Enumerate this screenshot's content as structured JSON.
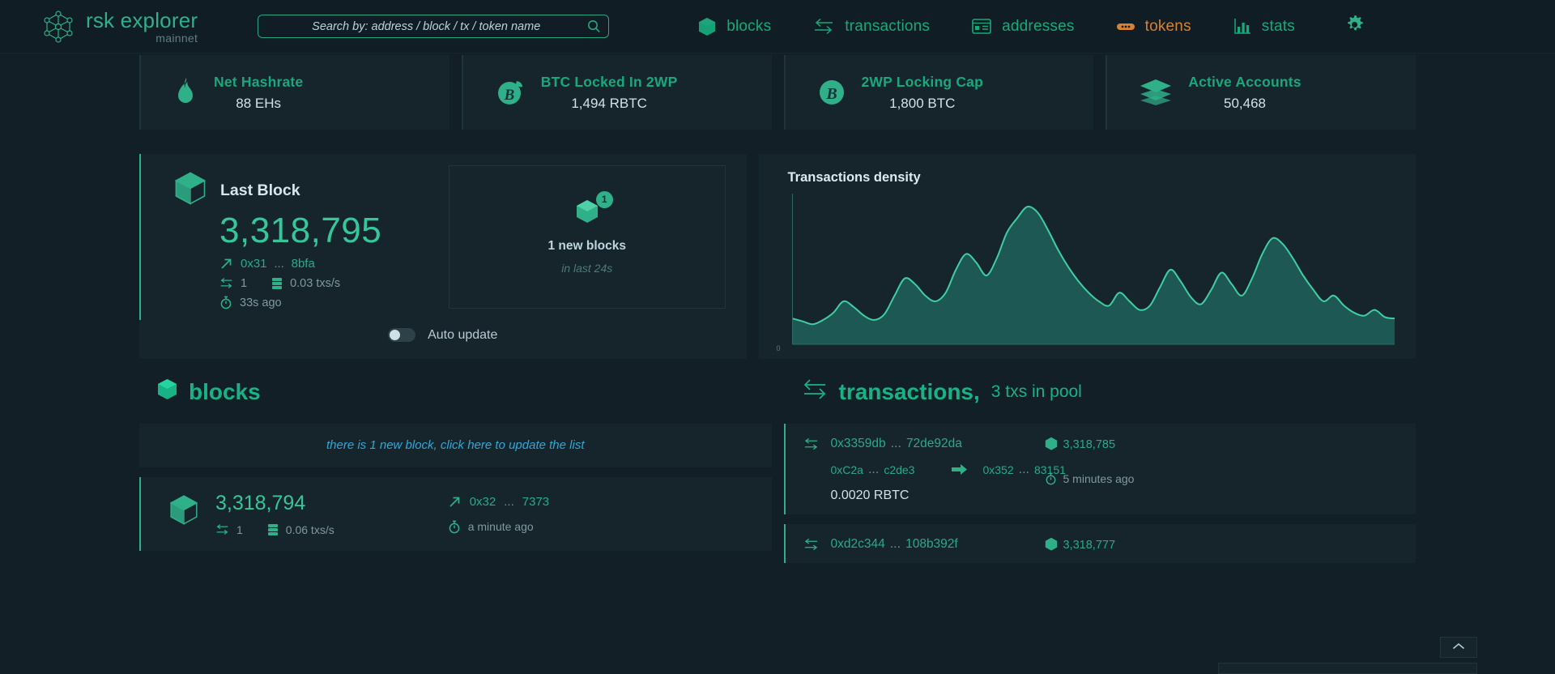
{
  "header": {
    "brand_title": "rsk explorer",
    "brand_sub": "mainnet",
    "logo_icon": "rsk-network-logo",
    "search": {
      "placeholder": "Search by: address / block / tx / token name",
      "value": "",
      "icon": "search-icon"
    },
    "nav": [
      {
        "label": "blocks",
        "icon": "cube-icon",
        "accent": false
      },
      {
        "label": "transactions",
        "icon": "swap-icon",
        "accent": false
      },
      {
        "label": "addresses",
        "icon": "card-icon",
        "accent": false
      },
      {
        "label": "tokens",
        "icon": "token-icon",
        "accent": true
      },
      {
        "label": "stats",
        "icon": "bar-chart-icon",
        "accent": false
      }
    ],
    "settings_icon": "gear-icon"
  },
  "stats": [
    {
      "label": "Net Hashrate",
      "value": "88 EHs",
      "icon": "flame-icon"
    },
    {
      "label": "BTC Locked In 2WP",
      "value": "1,494 RBTC",
      "icon": "bitcoin-leaf-icon"
    },
    {
      "label": "2WP Locking Cap",
      "value": "1,800 BTC",
      "icon": "bitcoin-icon"
    },
    {
      "label": "Active Accounts",
      "value": "50,468",
      "icon": "layers-icon"
    }
  ],
  "last_block": {
    "title": "Last Block",
    "icon": "cube-icon",
    "number": "3,318,795",
    "hash_prefix": "0x31",
    "hash_dots": "...",
    "hash_suffix": "8bfa",
    "tx_count": "1",
    "tx_rate": "0.03 txs/s",
    "age": "33s ago"
  },
  "new_blocks": {
    "badge": "1",
    "title": "1 new blocks",
    "subtitle": "in last 24s",
    "icon": "cube-icon"
  },
  "auto_update": {
    "label": "Auto update",
    "enabled": false
  },
  "chart_data": {
    "type": "area",
    "title": "Transactions density",
    "xlabel": "",
    "ylabel": "",
    "ylim": [
      0,
      100
    ],
    "grid": false,
    "legend": "none",
    "axis_zero_label": "0",
    "line_color": "#3ecfa4",
    "fill_color": "#1d5c56",
    "x": [
      0,
      1,
      2,
      3,
      4,
      5,
      6,
      7,
      8,
      9,
      10,
      11,
      12,
      13,
      14,
      15,
      16,
      17,
      18,
      19,
      20,
      21,
      22,
      23,
      24,
      25,
      26,
      27,
      28,
      29,
      30,
      31,
      32,
      33,
      34,
      35,
      36,
      37,
      38,
      39,
      40,
      41,
      42,
      43,
      44,
      45,
      46,
      47,
      48,
      49,
      50,
      51,
      52,
      53,
      54
    ],
    "values": [
      18,
      16,
      14,
      17,
      22,
      30,
      26,
      20,
      17,
      21,
      34,
      46,
      42,
      34,
      30,
      36,
      52,
      63,
      57,
      48,
      60,
      78,
      88,
      96,
      92,
      80,
      66,
      54,
      44,
      36,
      30,
      27,
      36,
      30,
      24,
      27,
      40,
      52,
      44,
      33,
      28,
      38,
      50,
      42,
      34,
      46,
      63,
      74,
      70,
      60,
      48,
      38,
      30,
      34,
      27,
      22,
      20,
      24,
      19,
      18
    ]
  },
  "blocks_section": {
    "title": "blocks",
    "icon": "cube-icon",
    "notice": "there is 1 new block, click here to update the list",
    "rows": [
      {
        "number": "3,318,794",
        "tx_count": "1",
        "tx_rate": "0.06 txs/s",
        "hash_prefix": "0x32",
        "hash_dots": "...",
        "hash_suffix": "7373",
        "age": "a minute ago"
      }
    ]
  },
  "transactions_section": {
    "title": "transactions,",
    "subtitle": "3 txs in pool",
    "icon": "swap-icon",
    "rows": [
      {
        "hash_prefix": "0x3359db",
        "hash_dots": "...",
        "hash_suffix": "72de92da",
        "block": "3,318,785",
        "from_addr": "0xC2a",
        "from_dots": "...",
        "from_suffix": "c2de3",
        "to_addr": "0x352",
        "to_dots": "...",
        "to_suffix": "83151",
        "time": "5 minutes ago",
        "value": "0.0020 RBTC"
      },
      {
        "hash_prefix": "0xd2c344",
        "hash_dots": "...",
        "hash_suffix": "108b392f",
        "block": "3,318,777",
        "from_addr": "",
        "from_dots": "",
        "from_suffix": "",
        "to_addr": "",
        "to_dots": "",
        "to_suffix": "",
        "time": "",
        "value": ""
      }
    ]
  },
  "scroll_top": {
    "icon": "chevron-up-icon"
  },
  "colors": {
    "bg": "#131f26",
    "panel": "#16242c",
    "accent_green": "#2fb089",
    "text_green": "#19a87c",
    "accent_orange": "#d58232",
    "link_blue": "#2fa8d8"
  }
}
